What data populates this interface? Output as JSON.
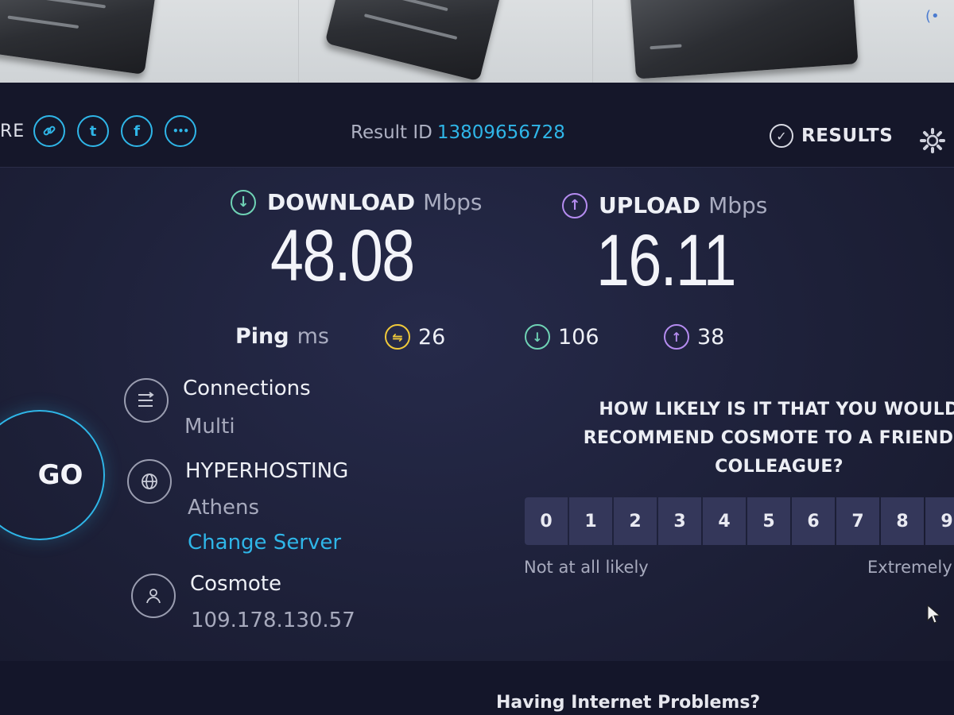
{
  "ad": {
    "adchoices_glyph": "(•"
  },
  "header": {
    "share_label": "RE",
    "share_buttons": [
      {
        "icon": "link-icon",
        "glyph": "🔗"
      },
      {
        "icon": "twitter-icon",
        "glyph": "t"
      },
      {
        "icon": "facebook-icon",
        "glyph": "f"
      },
      {
        "icon": "more-icon",
        "glyph": "•••"
      }
    ],
    "result_id_label": "Result ID",
    "result_id_value": "13809656728",
    "results_label": "RESULTS"
  },
  "download": {
    "label": "DOWNLOAD",
    "unit": "Mbps",
    "value": "48.08",
    "color": "#6fd3b5"
  },
  "upload": {
    "label": "UPLOAD",
    "unit": "Mbps",
    "value": "16.11",
    "color": "#b58cf0"
  },
  "ping": {
    "label": "Ping",
    "unit": "ms",
    "idle": "26",
    "download": "106",
    "upload": "38",
    "idle_color": "#f0c93a"
  },
  "go_label": "GO",
  "connections": {
    "title": "Connections",
    "value": "Multi"
  },
  "server": {
    "name": "HYPERHOSTING",
    "location": "Athens",
    "change_label": "Change Server"
  },
  "isp": {
    "name": "Cosmote",
    "ip": "109.178.130.57"
  },
  "survey": {
    "question_line1": "HOW LIKELY IS IT THAT YOU WOULD",
    "question_line2": "RECOMMEND COSMOTE TO A FRIEND O",
    "question_line3": "COLLEAGUE?",
    "scale": [
      "0",
      "1",
      "2",
      "3",
      "4",
      "5",
      "6",
      "7",
      "8",
      "9"
    ],
    "low_label": "Not at all likely",
    "high_label": "Extremely"
  },
  "footer": {
    "problems_text": "Having Internet Problems?"
  },
  "accent_color": "#2fb6e8"
}
